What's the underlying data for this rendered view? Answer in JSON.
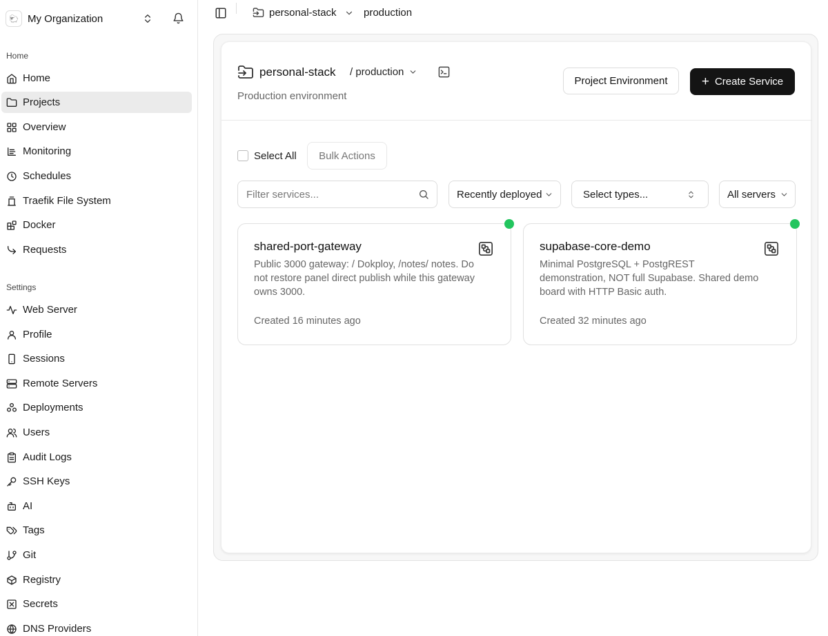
{
  "sidebar": {
    "org_name": "My Organization",
    "org_logo": "🐑",
    "sections": [
      {
        "label": "Home",
        "items": [
          {
            "label": "Home",
            "icon": "home-icon"
          },
          {
            "label": "Projects",
            "icon": "folder-icon",
            "active": true
          },
          {
            "label": "Overview",
            "icon": "grid-icon"
          },
          {
            "label": "Monitoring",
            "icon": "monitoring-icon"
          },
          {
            "label": "Schedules",
            "icon": "clock-icon"
          },
          {
            "label": "Traefik File System",
            "icon": "file-system-icon"
          },
          {
            "label": "Docker",
            "icon": "blocks-icon"
          },
          {
            "label": "Requests",
            "icon": "forward-arrow-icon"
          }
        ]
      },
      {
        "label": "Settings",
        "items": [
          {
            "label": "Web Server",
            "icon": "activity-icon"
          },
          {
            "label": "Profile",
            "icon": "user-icon"
          },
          {
            "label": "Sessions",
            "icon": "phone-icon"
          },
          {
            "label": "Remote Servers",
            "icon": "server-icon"
          },
          {
            "label": "Deployments",
            "icon": "deployments-icon"
          },
          {
            "label": "Users",
            "icon": "users-icon"
          },
          {
            "label": "Audit Logs",
            "icon": "clipboard-icon"
          },
          {
            "label": "SSH Keys",
            "icon": "key-icon"
          },
          {
            "label": "AI",
            "icon": "bot-icon"
          },
          {
            "label": "Tags",
            "icon": "tags-icon"
          },
          {
            "label": "Git",
            "icon": "git-branch-icon"
          },
          {
            "label": "Registry",
            "icon": "package-icon"
          },
          {
            "label": "Secrets",
            "icon": "secret-box-icon"
          },
          {
            "label": "DNS Providers",
            "icon": "globe-icon"
          }
        ]
      }
    ]
  },
  "topbar": {
    "project": "personal-stack",
    "environment": "production"
  },
  "project": {
    "name": "personal-stack",
    "environment": "/ production",
    "description": "Production environment",
    "env_button": "Project Environment",
    "create_button": "Create Service"
  },
  "toolbar": {
    "select_all": "Select All",
    "bulk_actions": "Bulk Actions",
    "filter_placeholder": "Filter services...",
    "sort": "Recently deployed",
    "types": "Select types...",
    "servers": "All servers"
  },
  "services": [
    {
      "name": "shared-port-gateway",
      "description": "Public 3000 gateway: / Dokploy, /notes/ notes. Do not restore panel direct publish while this gateway owns 3000.",
      "created": "Created 16 minutes ago",
      "status_color": "#22c55e"
    },
    {
      "name": "supabase-core-demo",
      "description": "Minimal PostgreSQL + PostgREST demonstration, NOT full Supabase. Shared demo board with HTTP Basic auth.",
      "created": "Created 32 minutes ago",
      "status_color": "#22c55e"
    }
  ]
}
